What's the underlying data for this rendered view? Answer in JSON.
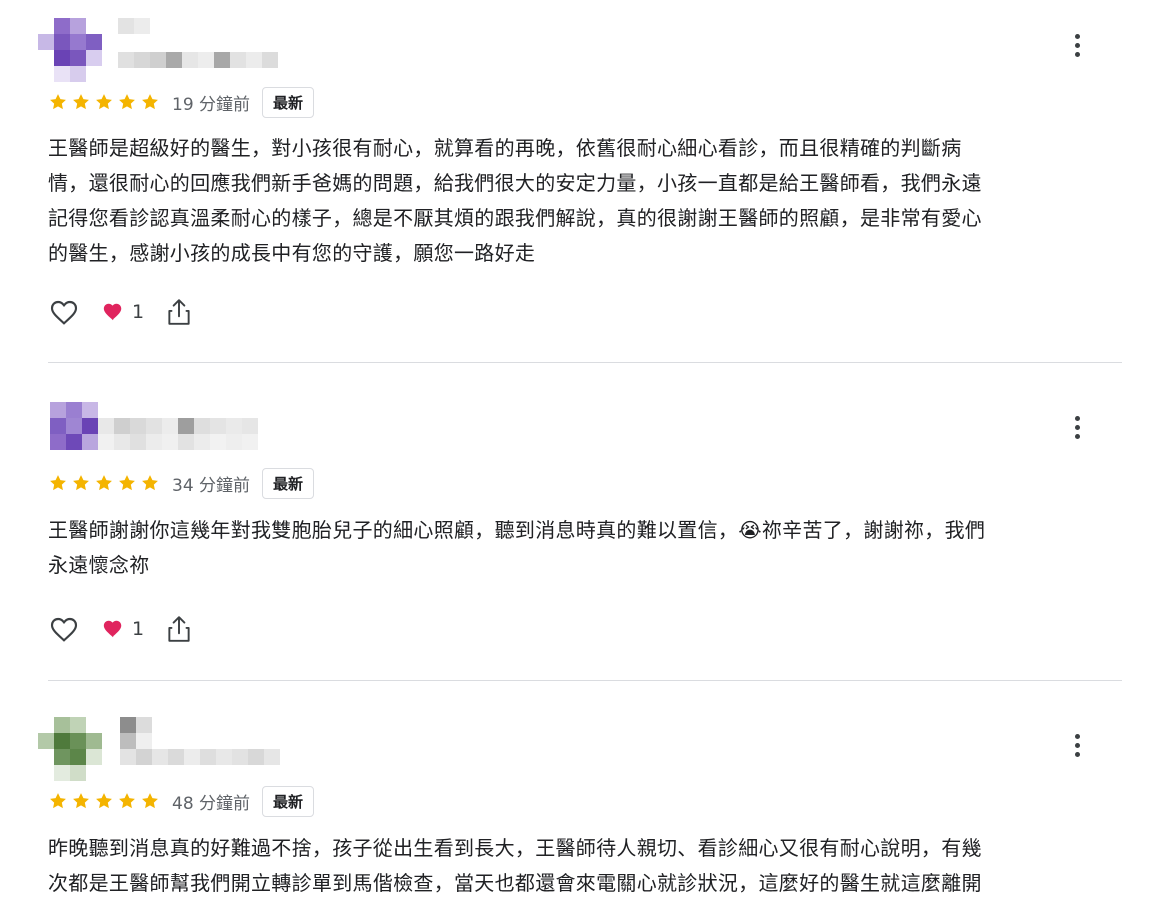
{
  "colors": {
    "star": "#f4b400",
    "heart": "#e0245e",
    "text": "#202124",
    "muted": "#5f6368",
    "divider": "#dadce0"
  },
  "icons": {
    "more": "more-vert-icon",
    "star": "star-icon",
    "like": "heart-outline-icon",
    "reaction": "red-heart-icon",
    "share": "share-icon"
  },
  "reviews": [
    {
      "rating": 5,
      "time": "19 分鐘前",
      "badge": "最新",
      "lines": [
        "王醫師是超級好的醫生，對小孩很有耐心，就算看的再晚，依舊很耐心細心看診，而且很精確的判斷病",
        "情，還很耐心的回應我們新手爸媽的問題，給我們很大的安定力量，小孩一直都是給王醫師看，我們永遠",
        "記得您看診認真溫柔耐心的樣子，總是不厭其煩的跟我們解說，真的很謝謝王醫師的照顧，是非常有愛心",
        "的醫生，感謝小孩的成長中有您的守護，願您一路好走"
      ],
      "reaction_count": "1"
    },
    {
      "rating": 5,
      "time": "34 分鐘前",
      "badge": "最新",
      "lines": [
        "王醫師謝謝你這幾年對我雙胞胎兒子的細心照顧，聽到消息時真的難以置信，😭祢辛苦了，謝謝祢，我們",
        "永遠懷念祢"
      ],
      "reaction_count": "1"
    },
    {
      "rating": 5,
      "time": "48 分鐘前",
      "badge": "最新",
      "lines": [
        "昨晚聽到消息真的好難過不捨，孩子從出生看到長大，王醫師待人親切、看診細心又很有耐心說明，有幾",
        "次都是王醫師幫我們開立轉診單到馬偕檢查，當天也都還會來電關心就診狀況，這麼好的醫生就這麼離開"
      ]
    }
  ]
}
